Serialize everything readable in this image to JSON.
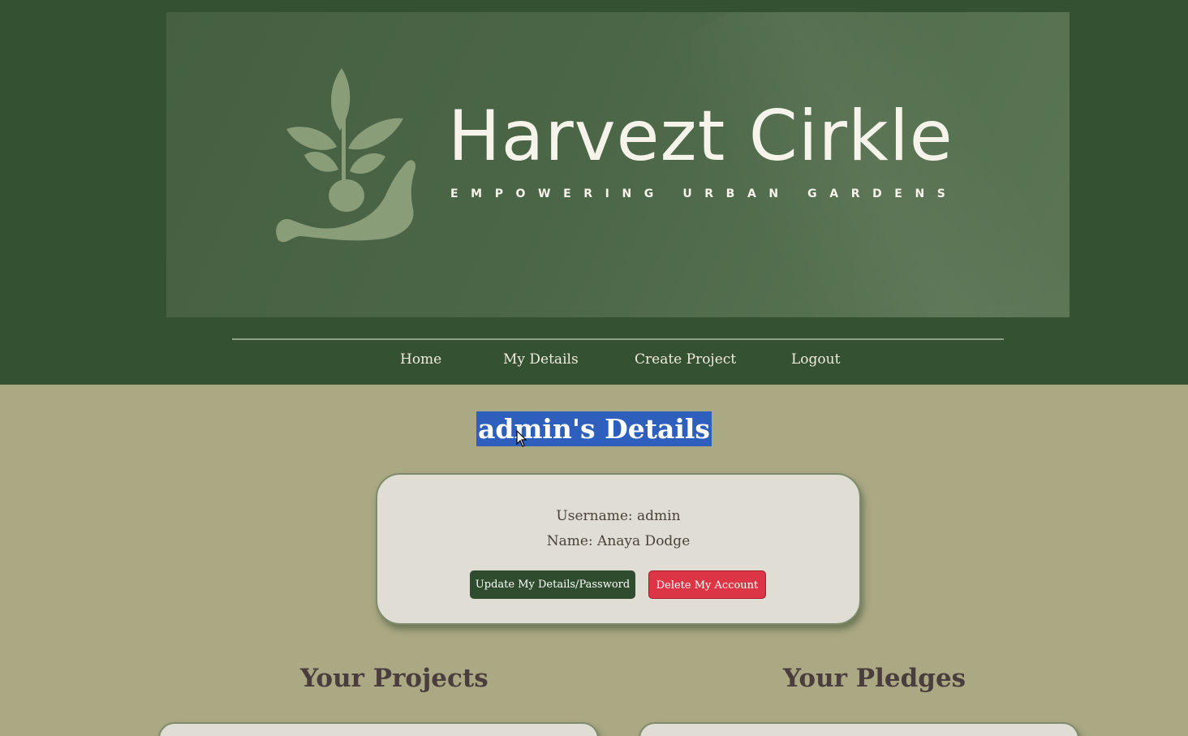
{
  "banner": {
    "brand_name": "Harvezt Cirkle",
    "tagline": "EMPOWERING URBAN GARDENS",
    "logo_icon": "plant-in-hand-icon"
  },
  "nav": {
    "items": [
      {
        "label": "Home"
      },
      {
        "label": "My Details"
      },
      {
        "label": "Create Project"
      },
      {
        "label": "Logout"
      }
    ]
  },
  "page": {
    "title": "admin's Details"
  },
  "details": {
    "username": "Username: admin",
    "name": "Name: Anaya Dodge",
    "update_label": "Update My Details/Password",
    "delete_label": "Delete My Account"
  },
  "sections": {
    "projects_title": "Your Projects",
    "pledges_title": "Your Pledges"
  },
  "colors": {
    "header_bg": "#345132",
    "page_bg": "#aba884",
    "card_bg": "#e0ded4",
    "update_btn": "#2f4d2e",
    "delete_btn": "#dc3545",
    "selection": "#2e5fbd"
  }
}
